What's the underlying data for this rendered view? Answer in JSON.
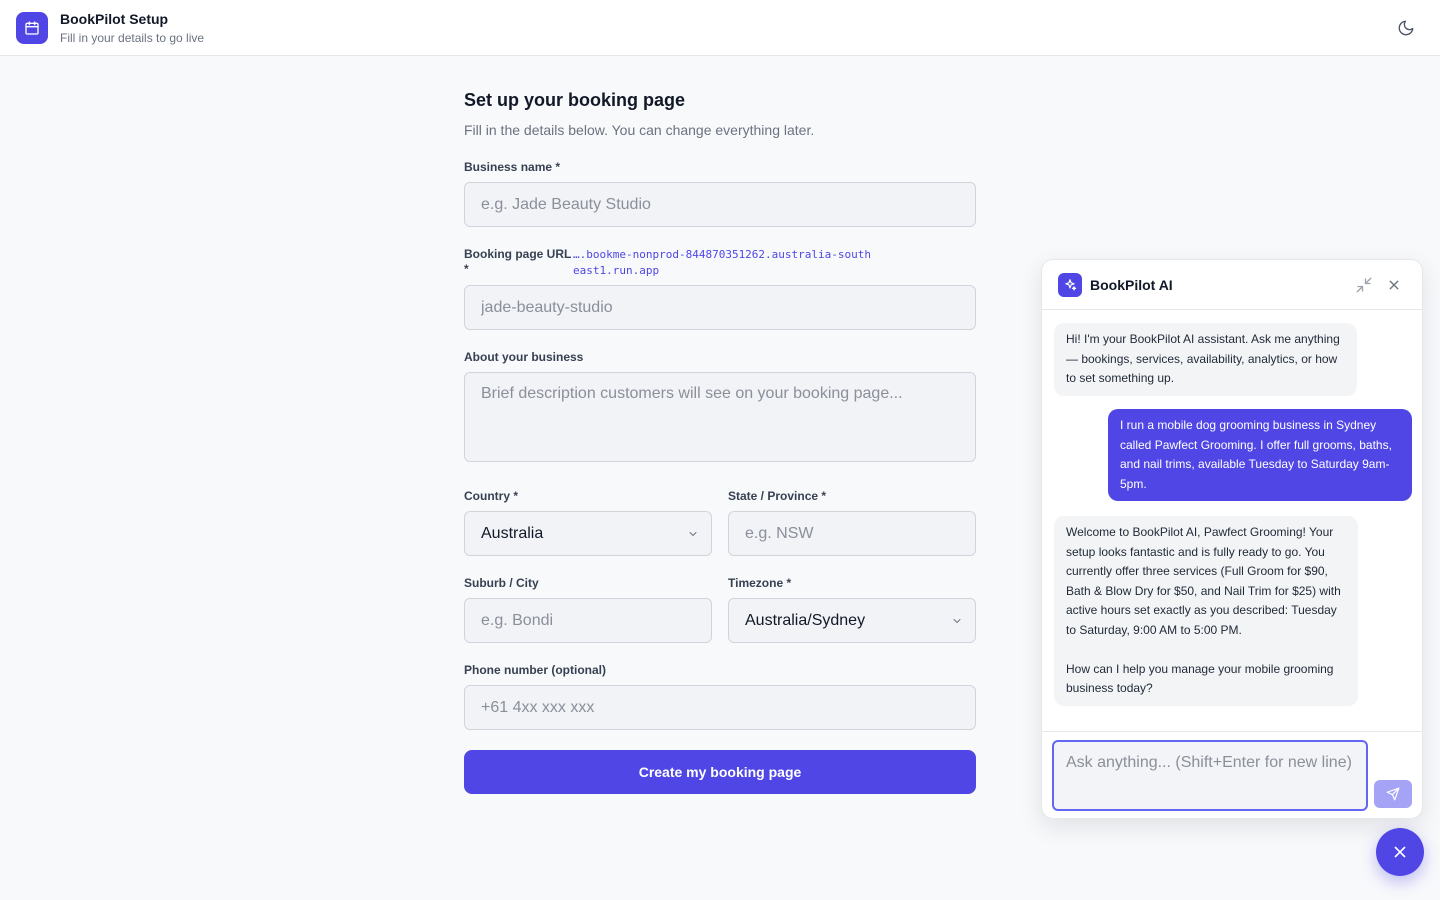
{
  "header": {
    "title": "BookPilot Setup",
    "subtitle": "Fill in your details to go live",
    "logo_icon": "calendar-icon",
    "theme_icon": "moon-icon"
  },
  "form": {
    "title": "Set up your booking page",
    "subtitle": "Fill in the details below. You can change everything later.",
    "business_name": {
      "label": "Business name *",
      "placeholder": "e.g. Jade Beauty Studio",
      "value": ""
    },
    "booking_url": {
      "label": "Booking page URL *",
      "prefix": "….bookme-nonprod-844870351262.australia-southeast1.run.app",
      "placeholder": "jade-beauty-studio",
      "value": ""
    },
    "about": {
      "label": "About your business",
      "placeholder": "Brief description customers will see on your booking page...",
      "value": ""
    },
    "country": {
      "label": "Country *",
      "value": "Australia"
    },
    "state": {
      "label": "State / Province *",
      "placeholder": "e.g. NSW",
      "value": ""
    },
    "suburb": {
      "label": "Suburb / City",
      "placeholder": "e.g. Bondi",
      "value": ""
    },
    "timezone": {
      "label": "Timezone *",
      "value": "Australia/Sydney"
    },
    "phone": {
      "label": "Phone number (optional)",
      "placeholder": "+61 4xx xxx xxx",
      "value": ""
    },
    "submit_label": "Create my booking page"
  },
  "chat": {
    "title": "BookPilot AI",
    "messages": [
      {
        "role": "assistant",
        "text": "Hi! I'm your BookPilot AI assistant. Ask me anything — bookings, services, availability, analytics, or how to set something up."
      },
      {
        "role": "user",
        "text": "I run a mobile dog grooming business in Sydney called Pawfect Grooming. I offer full grooms, baths, and nail trims, available Tuesday to Saturday 9am-5pm."
      },
      {
        "role": "assistant",
        "text": "Welcome to BookPilot AI, Pawfect Grooming! Your setup looks fantastic and is fully ready to go. You currently offer three services (Full Groom for $90, Bath & Blow Dry for $50, and Nail Trim for $25) with active hours set exactly as you described: Tuesday to Saturday, 9:00 AM to 5:00 PM.\n\nHow can I help you manage your mobile grooming business today?"
      }
    ],
    "input_placeholder": "Ask anything... (Shift+Enter for new line)",
    "input_value": ""
  },
  "colors": {
    "accent": "#4f46e5",
    "background": "#f8f9fb",
    "field_bg": "#f1f3f7",
    "border": "#d1d5db",
    "text": "#111827",
    "muted": "#6b7280"
  }
}
